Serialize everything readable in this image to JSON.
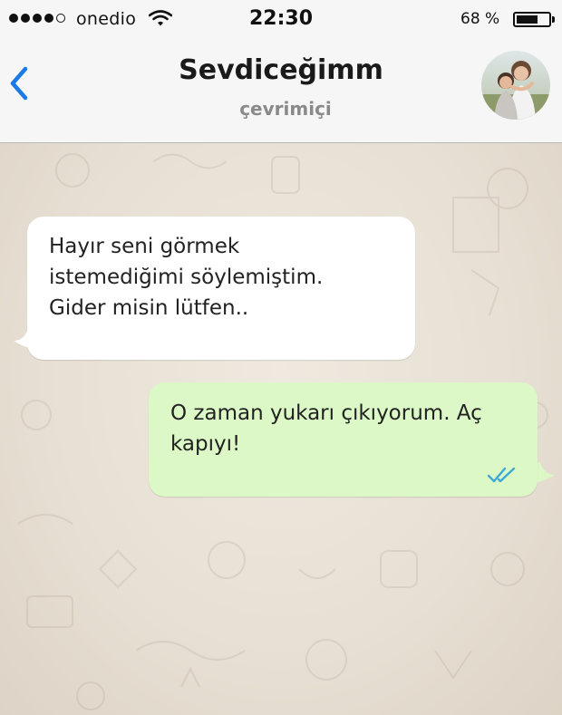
{
  "status_bar": {
    "carrier": "onedio",
    "time": "22:30",
    "battery_percent": "68 %",
    "battery_level": 0.68,
    "signal_bars_filled": 4,
    "signal_bars_total": 5
  },
  "header": {
    "contact_name": "Sevdiceğimm",
    "contact_status": "çevrimiçi",
    "back_icon": "chevron-left-icon",
    "accent_color": "#1a7ae6"
  },
  "messages": [
    {
      "direction": "incoming",
      "text": "Hayır seni görmek\nistemediğimi söylemiştim.\nGider misin lütfen.."
    },
    {
      "direction": "outgoing",
      "text": "O zaman yukarı çıkıyorum. Aç\nkapıyı!",
      "status_icon": "double-check-icon"
    }
  ],
  "colors": {
    "incoming_bubble": "#ffffff",
    "outgoing_bubble": "#dcf8c6",
    "read_ticks": "#3fa9d6",
    "chat_background": "#e9e1d6"
  }
}
